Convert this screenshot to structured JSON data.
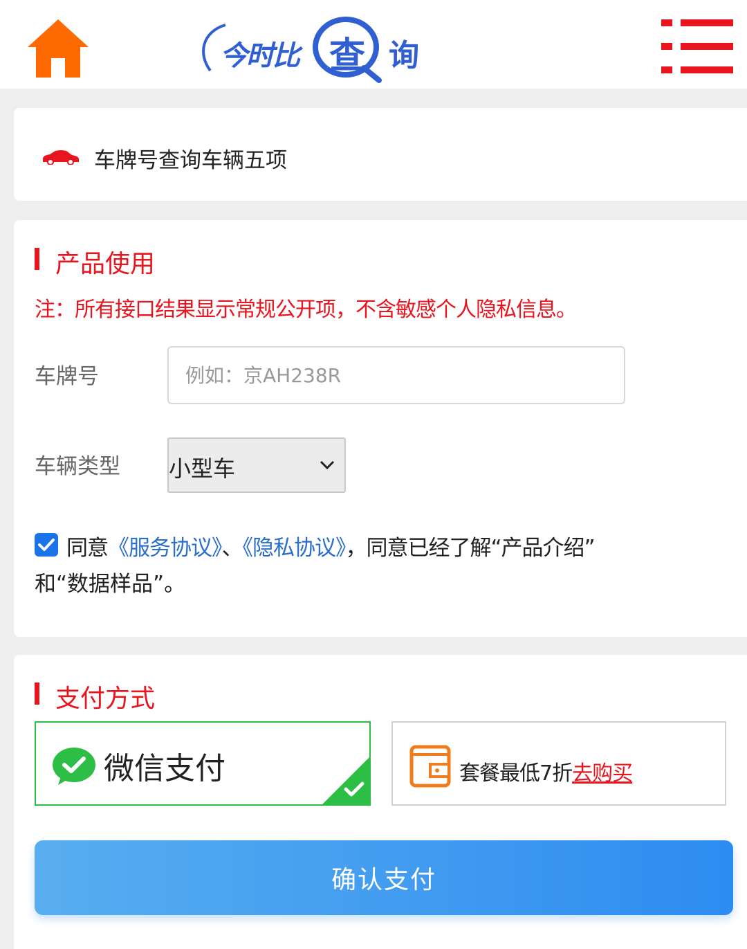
{
  "header": {
    "logo_text_left": "今时比",
    "logo_text_center": "查",
    "logo_text_right": "询",
    "home_icon": "home-icon",
    "menu_icon": "menu-icon",
    "colors": {
      "home": "#ff6a00",
      "menu": "#e8141e",
      "logo": "#2f5fd0"
    }
  },
  "product": {
    "icon": "car-icon",
    "title": "车牌号查询车辆五项"
  },
  "usage": {
    "section_title": "产品使用",
    "note": "注：所有接口结果显示常规公开项，不含敏感个人隐私信息。",
    "plate_label": "车牌号",
    "plate_placeholder": "例如：京AH238R",
    "plate_value": "",
    "type_label": "车辆类型",
    "type_selected": "小型车",
    "agree_checked": true,
    "agree_prefix": "同意",
    "service_link": "《服务协议》",
    "separator": "、",
    "privacy_link": "《隐私协议》",
    "agree_middle": "，同意已经了解“产品介绍”",
    "agree_line2": "和“数据样品”。"
  },
  "payment": {
    "section_title": "支付方式",
    "wechat_label": "微信支付",
    "package_text": "套餐最低7折",
    "buy_link": "去购买",
    "confirm_label": "确认支付",
    "colors": {
      "wechat": "#2dbf45",
      "accent": "#e8141e",
      "button": "#2d8cf0",
      "wallet": "#f07c1e"
    }
  }
}
